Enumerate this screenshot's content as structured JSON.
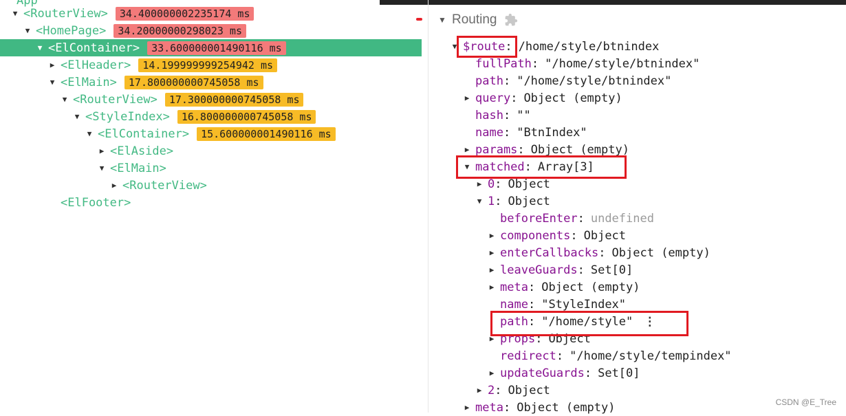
{
  "tree": {
    "top_partial": "App",
    "nodes": [
      {
        "name": "<RouterView>",
        "expand": "open",
        "badge": "34.400000002235174 ms",
        "badge_color": "red"
      },
      {
        "name": "<HomePage>",
        "expand": "open",
        "badge": "34.20000000298023 ms",
        "badge_color": "red"
      },
      {
        "name": "<ElContainer>",
        "expand": "open",
        "badge": "33.600000001490116 ms",
        "badge_color": "red",
        "selected": true
      },
      {
        "name": "<ElHeader>",
        "expand": "closed",
        "badge": "14.199999999254942 ms",
        "badge_color": "orange"
      },
      {
        "name": "<ElMain>",
        "expand": "open",
        "badge": "17.800000000745058 ms",
        "badge_color": "orange"
      },
      {
        "name": "<RouterView>",
        "expand": "open",
        "badge": "17.300000000745058 ms",
        "badge_color": "orange"
      },
      {
        "name": "<StyleIndex>",
        "expand": "open",
        "badge": "16.800000000745058 ms",
        "badge_color": "orange"
      },
      {
        "name": "<ElContainer>",
        "expand": "open",
        "badge": "15.600000001490116 ms",
        "badge_color": "orange"
      },
      {
        "name": "<ElAside>",
        "expand": "closed",
        "badge": "",
        "badge_color": ""
      },
      {
        "name": "<ElMain>",
        "expand": "open",
        "badge": "",
        "badge_color": ""
      },
      {
        "name": "<RouterView>",
        "expand": "closed",
        "badge": "",
        "badge_color": ""
      },
      {
        "name": "<ElFooter>",
        "expand": "none",
        "badge": "",
        "badge_color": ""
      }
    ]
  },
  "inspector": {
    "section_title": "Routing",
    "section_icon": "puzzle-icon",
    "rows": [
      {
        "key": "$route",
        "value": "/home/style/btnindex",
        "expand": "open"
      },
      {
        "key": "fullPath",
        "value": "\"/home/style/btnindex\"",
        "expand": "none"
      },
      {
        "key": "path",
        "value": "\"/home/style/btnindex\"",
        "expand": "none"
      },
      {
        "key": "query",
        "value": "Object (empty)",
        "expand": "closed"
      },
      {
        "key": "hash",
        "value": "\"\"",
        "expand": "none"
      },
      {
        "key": "name",
        "value": "\"BtnIndex\"",
        "expand": "none"
      },
      {
        "key": "params",
        "value": "Object (empty)",
        "expand": "closed"
      },
      {
        "key": "matched",
        "value": "Array[3]",
        "expand": "open"
      },
      {
        "key": "0",
        "value": "Object",
        "expand": "closed"
      },
      {
        "key": "1",
        "value": "Object",
        "expand": "open"
      },
      {
        "key": "beforeEnter",
        "value": "undefined",
        "expand": "none",
        "muted": true
      },
      {
        "key": "components",
        "value": "Object",
        "expand": "closed"
      },
      {
        "key": "enterCallbacks",
        "value": "Object (empty)",
        "expand": "closed"
      },
      {
        "key": "leaveGuards",
        "value": "Set[0]",
        "expand": "closed"
      },
      {
        "key": "meta",
        "value": "Object (empty)",
        "expand": "closed"
      },
      {
        "key": "name",
        "value": "\"StyleIndex\"",
        "expand": "none"
      },
      {
        "key": "path",
        "value": "\"/home/style\"",
        "expand": "none",
        "kebab": "⋮"
      },
      {
        "key": "props",
        "value": "Object",
        "expand": "closed"
      },
      {
        "key": "redirect",
        "value": "\"/home/style/tempindex\"",
        "expand": "none"
      },
      {
        "key": "updateGuards",
        "value": "Set[0]",
        "expand": "closed"
      },
      {
        "key": "2",
        "value": "Object",
        "expand": "closed"
      },
      {
        "key": "meta",
        "value": "Object (empty)",
        "expand": "closed"
      }
    ]
  },
  "watermark": "CSDN @E_Tree",
  "colors": {
    "accent_green": "#41b883",
    "badge_red": "#f37a7a",
    "badge_orange": "#f7bb26",
    "annotation_red": "#e11a21",
    "key_purple": "#881391"
  }
}
